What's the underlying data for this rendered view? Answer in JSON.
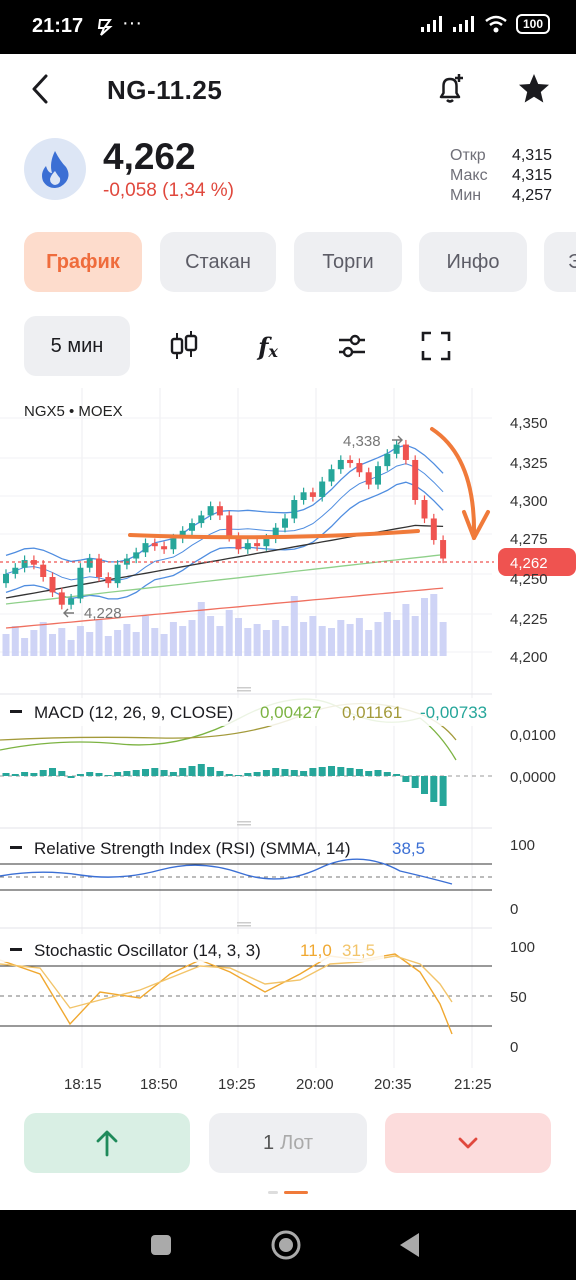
{
  "status_bar": {
    "time": "21:17",
    "battery": "100"
  },
  "header": {
    "ticker": "NG-11.25"
  },
  "quote": {
    "price": "4,262",
    "change": "-0,058 (1,34 %)",
    "stats": [
      {
        "label": "Откр",
        "value": "4,315"
      },
      {
        "label": "Макс",
        "value": "4,315"
      },
      {
        "label": "Мин",
        "value": "4,257"
      }
    ]
  },
  "tabs": [
    {
      "label": "График",
      "active": true
    },
    {
      "label": "Стакан",
      "active": false
    },
    {
      "label": "Торги",
      "active": false
    },
    {
      "label": "Инфо",
      "active": false
    },
    {
      "label": "Э",
      "active": false
    }
  ],
  "toolbar": {
    "timeframe": "5 мин"
  },
  "chart": {
    "source_label": "NGX5 • MOEX",
    "price_ticks": [
      "4,350",
      "4,325",
      "4,300",
      "4,275",
      "4,250",
      "4,225",
      "4,200"
    ],
    "current_price_label": "4,262",
    "high_marker": "4,338",
    "low_marker": "4,228",
    "time_ticks": [
      "18:15",
      "18:50",
      "19:25",
      "20:00",
      "20:35",
      "21:25"
    ],
    "macd": {
      "label": "MACD (12, 26, 9, CLOSE)",
      "v1": "0,00427",
      "v2": "0,01161",
      "v3": "-0,00733",
      "ticks": [
        "0,0100",
        "0,0000"
      ]
    },
    "rsi": {
      "label": "Relative Strength Index (RSI) (SMMA, 14)",
      "value": "38,5",
      "ticks": [
        "100",
        "0"
      ]
    },
    "stoch": {
      "label": "Stochastic Oscillator (14, 3, 3)",
      "k": "11,0",
      "d": "31,5",
      "ticks": [
        "100",
        "50",
        "0"
      ]
    },
    "colors": {
      "up": "#26a69a",
      "down": "#ef5350",
      "accent": "#f07a3a",
      "price_badge": "#ef5350"
    }
  },
  "actions": {
    "lot_count": "1",
    "lot_unit": "Лот"
  }
}
